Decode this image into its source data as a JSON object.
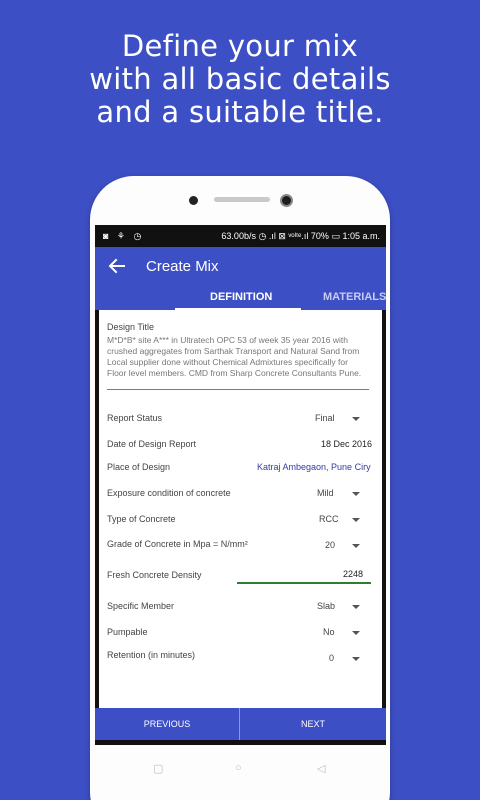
{
  "headline": [
    "Define your mix",
    "with all basic details",
    "and a suitable title."
  ],
  "status_bar": {
    "left_icons": "◙ ⚘ ◷",
    "network_speed": "63.00b/s",
    "right_icons": "◷ .ıl ⊠ ᵛᵒˡᵗᵉ.ıl",
    "battery": "70%",
    "battery_icon": "▭",
    "time": "1:05 a.m."
  },
  "app_bar": {
    "title": "Create Mix",
    "back_icon": "arrow-left-icon",
    "tabs": [
      {
        "label": "DEFINITION"
      },
      {
        "label": "MATERIALS"
      }
    ]
  },
  "form": {
    "design_title": {
      "label": "Design Title",
      "value": "M*D*B* site A*** in Ultratech OPC 53 of week 35 year 2016 with crushed aggregates from Sarthak Transport and Natural Sand from Local supplier done without Chemical Admixtures specifically for Floor level members. CMD from Sharp Concrete Consultants Pune."
    },
    "report_status": {
      "label": "Report Status",
      "value": "Final"
    },
    "date_of_design_report": {
      "label": "Date of Design Report",
      "value": "18 Dec 2016"
    },
    "place_of_design": {
      "label": "Place of Design",
      "value": "Katraj Ambegaon, Pune Ciry"
    },
    "exposure_condition": {
      "label": "Exposure condition of concrete",
      "value": "Mild"
    },
    "type_of_concrete": {
      "label": "Type of Concrete",
      "value": "RCC"
    },
    "grade_of_concrete": {
      "label": "Grade of Concrete in Mpa = N/mm²",
      "value": "20"
    },
    "fresh_concrete_density": {
      "label": "Fresh Concrete Density",
      "value": "2248"
    },
    "specific_member": {
      "label": "Specific Member",
      "value": "Slab"
    },
    "pumpable": {
      "label": "Pumpable",
      "value": "No"
    },
    "retention": {
      "label": "Retention (in minutes)",
      "value": "0"
    }
  },
  "buttons": {
    "previous": "PREVIOUS",
    "next": "NEXT"
  },
  "nav_bar": {
    "recent": "▢",
    "home": "○",
    "back": "◁"
  },
  "colors": {
    "primary": "#3d4fc4",
    "accent_line": "#2e7d32",
    "link_blue": "#2d3ea8"
  }
}
